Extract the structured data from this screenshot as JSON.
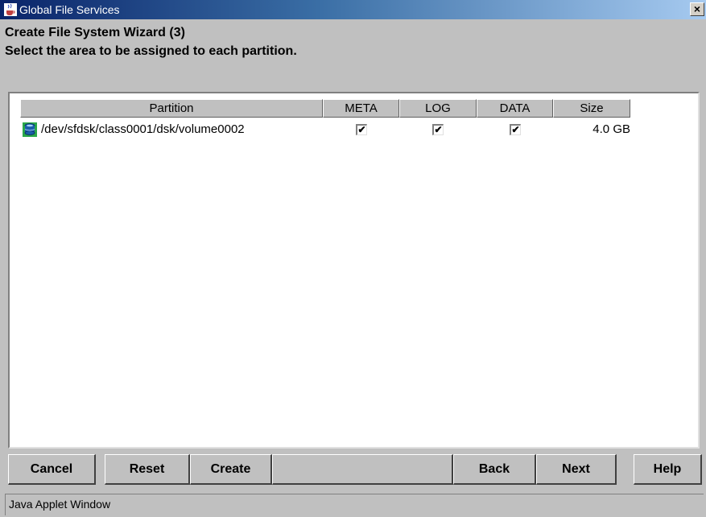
{
  "window": {
    "title": "Global File Services",
    "close_glyph": "×",
    "icon": "java-coffee-icon"
  },
  "wizard": {
    "heading": "Create File System Wizard (3)",
    "instruction": "Select the area to be assigned to each partition."
  },
  "table": {
    "columns": [
      "Partition",
      "META",
      "LOG",
      "DATA",
      "Size"
    ],
    "rows": [
      {
        "icon": "disk-volume-icon",
        "partition": "/dev/sfdsk/class0001/dsk/volume0002",
        "meta": true,
        "log": true,
        "data": true,
        "size": "4.0 GB"
      }
    ]
  },
  "buttons": {
    "cancel": "Cancel",
    "reset": "Reset",
    "create": "Create",
    "back": "Back",
    "next": "Next",
    "help": "Help"
  },
  "status_bar": "Java Applet Window",
  "colors": {
    "titlebar_start": "#0a246a",
    "titlebar_end": "#a6caf0",
    "face": "#c0c0c0",
    "disk_icon_primary": "#1a5ea8",
    "disk_icon_accent": "#2aa84a"
  }
}
